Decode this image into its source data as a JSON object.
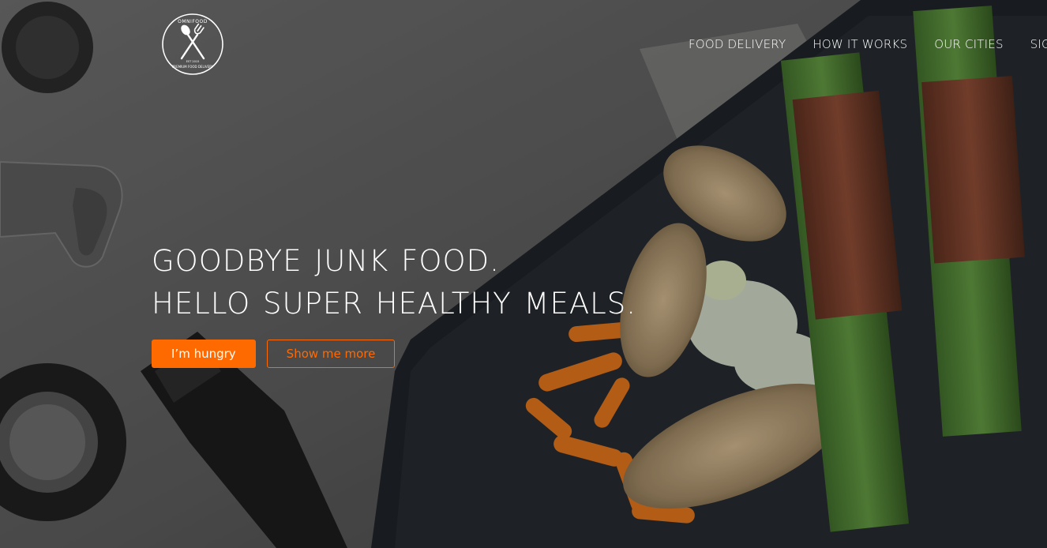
{
  "brand": {
    "logo_name": "OMNIFOOD",
    "logo_tagline": "PREMIUM FOOD DELIVERY",
    "logo_est": "EST 2015",
    "logo_icon": "fork-spoon-icon"
  },
  "nav": {
    "items": [
      {
        "label": "FOOD DELIVERY"
      },
      {
        "label": "HOW IT WORKS"
      },
      {
        "label": "OUR CITIES"
      },
      {
        "label": "SIGN UP"
      }
    ]
  },
  "hero": {
    "title_line1": "GOODBYE JUNK FOOD.",
    "title_line2": "HELLO SUPER HEALTHY MEALS.",
    "primary_button": "I’m hungry",
    "secondary_button": "Show me more"
  },
  "colors": {
    "accent": "#ff6a00",
    "text": "#ffffff",
    "overlay": "rgba(0,0,0,0.18)"
  }
}
